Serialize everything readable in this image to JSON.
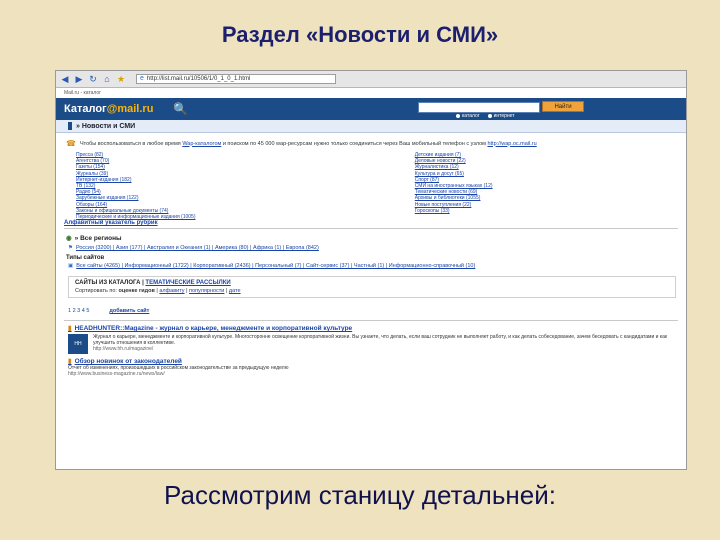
{
  "slide": {
    "title": "Раздел «Новости и СМИ»",
    "caption": "Рассмотрим станицу детальней:"
  },
  "browser": {
    "address": "http://list.mail.ru/10506/1/0_1_0_1.html"
  },
  "header": {
    "top_link": "Mail.ru - каталог",
    "logo_text": "Каталог",
    "logo_domain": "@mail.ru",
    "search_button": "Найти",
    "radio_catalog": "каталог",
    "radio_internet": "интернет"
  },
  "section": {
    "label": "» Новости и СМИ"
  },
  "intro": {
    "prefix": "Чтобы воспользоваться в любое время ",
    "link1": "Wap-каталогом",
    "middle": " и поиском по 45 000 wap-ресурсам нужно только соединиться через Ваш мобильный телефон с узлом ",
    "link2": "http://wap.ос.mail.ru"
  },
  "categories_left": [
    "Пресса (82)",
    "Агентства (70)",
    "Газеты (154)",
    "Журналы (39)",
    "Интернет-издания (182)",
    "ТВ (132)",
    "Радио (54)",
    "Зарубежные издания (122)",
    "Обзоры (164)",
    "Законы и официальные документы (74)",
    "Периодические и информационные издания (1005)"
  ],
  "categories_right": [
    "Детские издания (7)",
    "Деловые новости (22)",
    "Журналистика (12)",
    "Культура и досуг (65)",
    "Спорт (87)",
    "СМИ на иностранных языках (12)",
    "Тематические новости (69)",
    "Архивы и библиотеки (1055)",
    "Новые поступления (22)",
    "Гороскопы (33)"
  ],
  "alpha_index": "Алфавитный указатель рубрик",
  "regions": {
    "title": "» Все регионы",
    "items": "Россия (3200) | Азия (177) | Австралия и Океания (1) | Америка (80) | Африка (1) | Европа (842)"
  },
  "site_types": {
    "title": "Типы сайтов",
    "items": "Все сайты (4265) | Информационный (1722) | Корпоративный (2436) | Персональный (7) | Сайт-сервис (37) | Частный (1) | Информационно-справочный (10)"
  },
  "panel": {
    "tab1": "САЙТЫ ИЗ КАТАЛОГА",
    "tab2": "ТЕМАТИЧЕСКИЕ РАССЫЛКИ",
    "sort_label": "Сортировать по: ",
    "sort_current": "оценке гидов",
    "sort_alpha": "алфавиту",
    "sort_popular": "популярности",
    "sort_date": "дате"
  },
  "pagination": {
    "pages": "1 2 3 4 5",
    "add_site": "добавить сайт"
  },
  "listing": [
    {
      "title": "HEADHUNTER::Magazine - журнал о карьере, менеджменте и корпоративной культуре",
      "desc": "Журнал о карьере, менеджменте и корпоративной культуре. Многосторонне освещение корпоративной жизни. Вы узнаете, что делать, если ваш сотрудник не выполняет работу, и как делать собеседование, зачем беседовать с кандидатами и как улучшить отношения в коллективе.",
      "url": "http://www.hh.ru/magazine/"
    },
    {
      "title": "Обзор новинок от законодателей",
      "desc": "Отчет об изменениях, произошедших в российском законодательстве за предыдущую неделю",
      "url": "http://www.business-magazine.ru/news/law/"
    }
  ],
  "icons": {
    "back": "arrow-left-icon",
    "forward": "arrow-right-icon",
    "refresh": "refresh-icon",
    "home": "home-icon",
    "favorites": "star-icon",
    "search": "magnifier-icon"
  }
}
